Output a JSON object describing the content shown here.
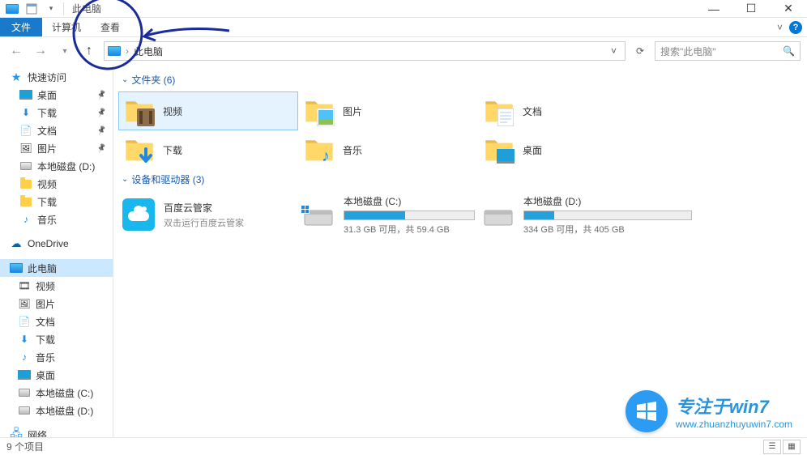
{
  "titlebar": {
    "title": "此电脑"
  },
  "ribbon": {
    "file": "文件",
    "tabs": [
      "计算机",
      "查看"
    ],
    "expand_hint": "˅"
  },
  "nav": {
    "location": "此电脑",
    "search_placeholder": "搜索\"此电脑\""
  },
  "sidebar": {
    "quick_access": "快速访问",
    "quick_items": [
      {
        "label": "桌面"
      },
      {
        "label": "下载"
      },
      {
        "label": "文档"
      },
      {
        "label": "图片"
      },
      {
        "label": "本地磁盘 (D:)"
      },
      {
        "label": "视频"
      },
      {
        "label": "下载"
      },
      {
        "label": "音乐"
      }
    ],
    "onedrive": "OneDrive",
    "this_pc": "此电脑",
    "pc_items": [
      {
        "label": "视频"
      },
      {
        "label": "图片"
      },
      {
        "label": "文档"
      },
      {
        "label": "下载"
      },
      {
        "label": "音乐"
      },
      {
        "label": "桌面"
      },
      {
        "label": "本地磁盘 (C:)"
      },
      {
        "label": "本地磁盘 (D:)"
      }
    ],
    "network": "网络"
  },
  "content": {
    "folders_header": "文件夹 (6)",
    "folders": [
      {
        "label": "视频"
      },
      {
        "label": "图片"
      },
      {
        "label": "文档"
      },
      {
        "label": "下载"
      },
      {
        "label": "音乐"
      },
      {
        "label": "桌面"
      }
    ],
    "devices_header": "设备和驱动器 (3)",
    "baidu": {
      "name": "百度云管家",
      "sub": "双击运行百度云管家"
    },
    "drives": [
      {
        "name": "本地磁盘 (C:)",
        "stats": "31.3 GB 可用，共 59.4 GB",
        "fill_pct": 47
      },
      {
        "name": "本地磁盘 (D:)",
        "stats": "334 GB 可用，共 405 GB",
        "fill_pct": 18
      }
    ]
  },
  "statusbar": {
    "count": "9 个项目"
  },
  "watermark": {
    "title": "专注于win7",
    "url": "www.zhuanzhuyuwin7.com"
  }
}
